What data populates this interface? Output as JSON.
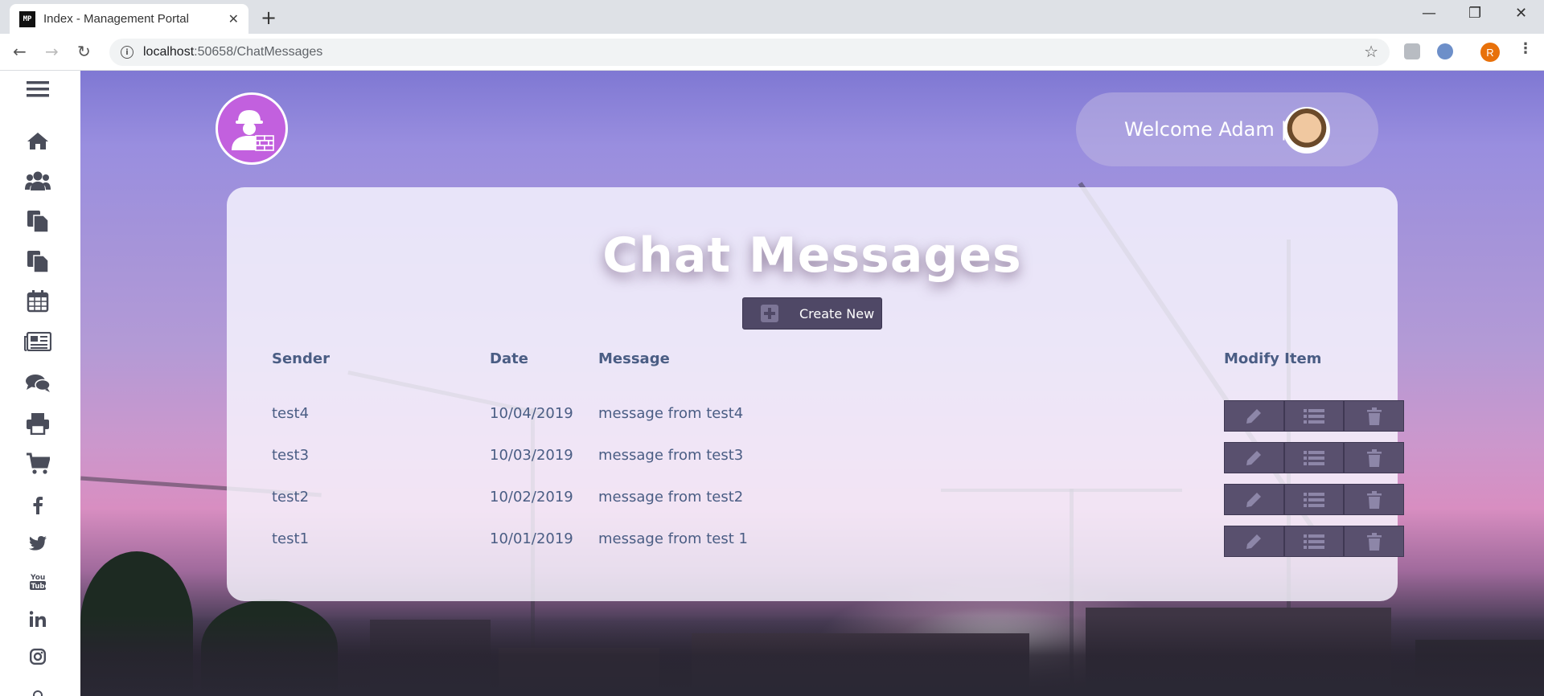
{
  "browser": {
    "tab_title": "Index - Management Portal",
    "favicon_text": "MP",
    "url_host": "localhost",
    "url_path": ":50658/ChatMessages",
    "profile_initial": "R"
  },
  "sidebar": {
    "items": [
      {
        "icon": "menu-icon"
      },
      {
        "icon": "home-icon"
      },
      {
        "icon": "users-icon"
      },
      {
        "icon": "documents-icon"
      },
      {
        "icon": "files-icon"
      },
      {
        "icon": "calendar-icon"
      },
      {
        "icon": "news-icon"
      },
      {
        "icon": "chat-icon"
      },
      {
        "icon": "print-icon"
      },
      {
        "icon": "cart-icon"
      },
      {
        "icon": "facebook-icon"
      },
      {
        "icon": "twitter-icon"
      },
      {
        "icon": "youtube-icon"
      },
      {
        "icon": "linkedin-icon"
      },
      {
        "icon": "instagram-icon"
      }
    ]
  },
  "header": {
    "welcome_text": "Welcome Adam |"
  },
  "main": {
    "title": "Chat Messages",
    "create_label": "Create New",
    "columns": {
      "sender": "Sender",
      "date": "Date",
      "message": "Message",
      "modify": "Modify Item"
    },
    "rows": [
      {
        "sender": "test4",
        "date": "10/04/2019",
        "message": "message from test4"
      },
      {
        "sender": "test3",
        "date": "10/03/2019",
        "message": "message from test3"
      },
      {
        "sender": "test2",
        "date": "10/02/2019",
        "message": "message from test2"
      },
      {
        "sender": "test1",
        "date": "10/01/2019",
        "message": "message from test 1"
      }
    ]
  },
  "colors": {
    "accent": "#4f4866",
    "text": "#4a5d84",
    "logo": "#c260de"
  }
}
